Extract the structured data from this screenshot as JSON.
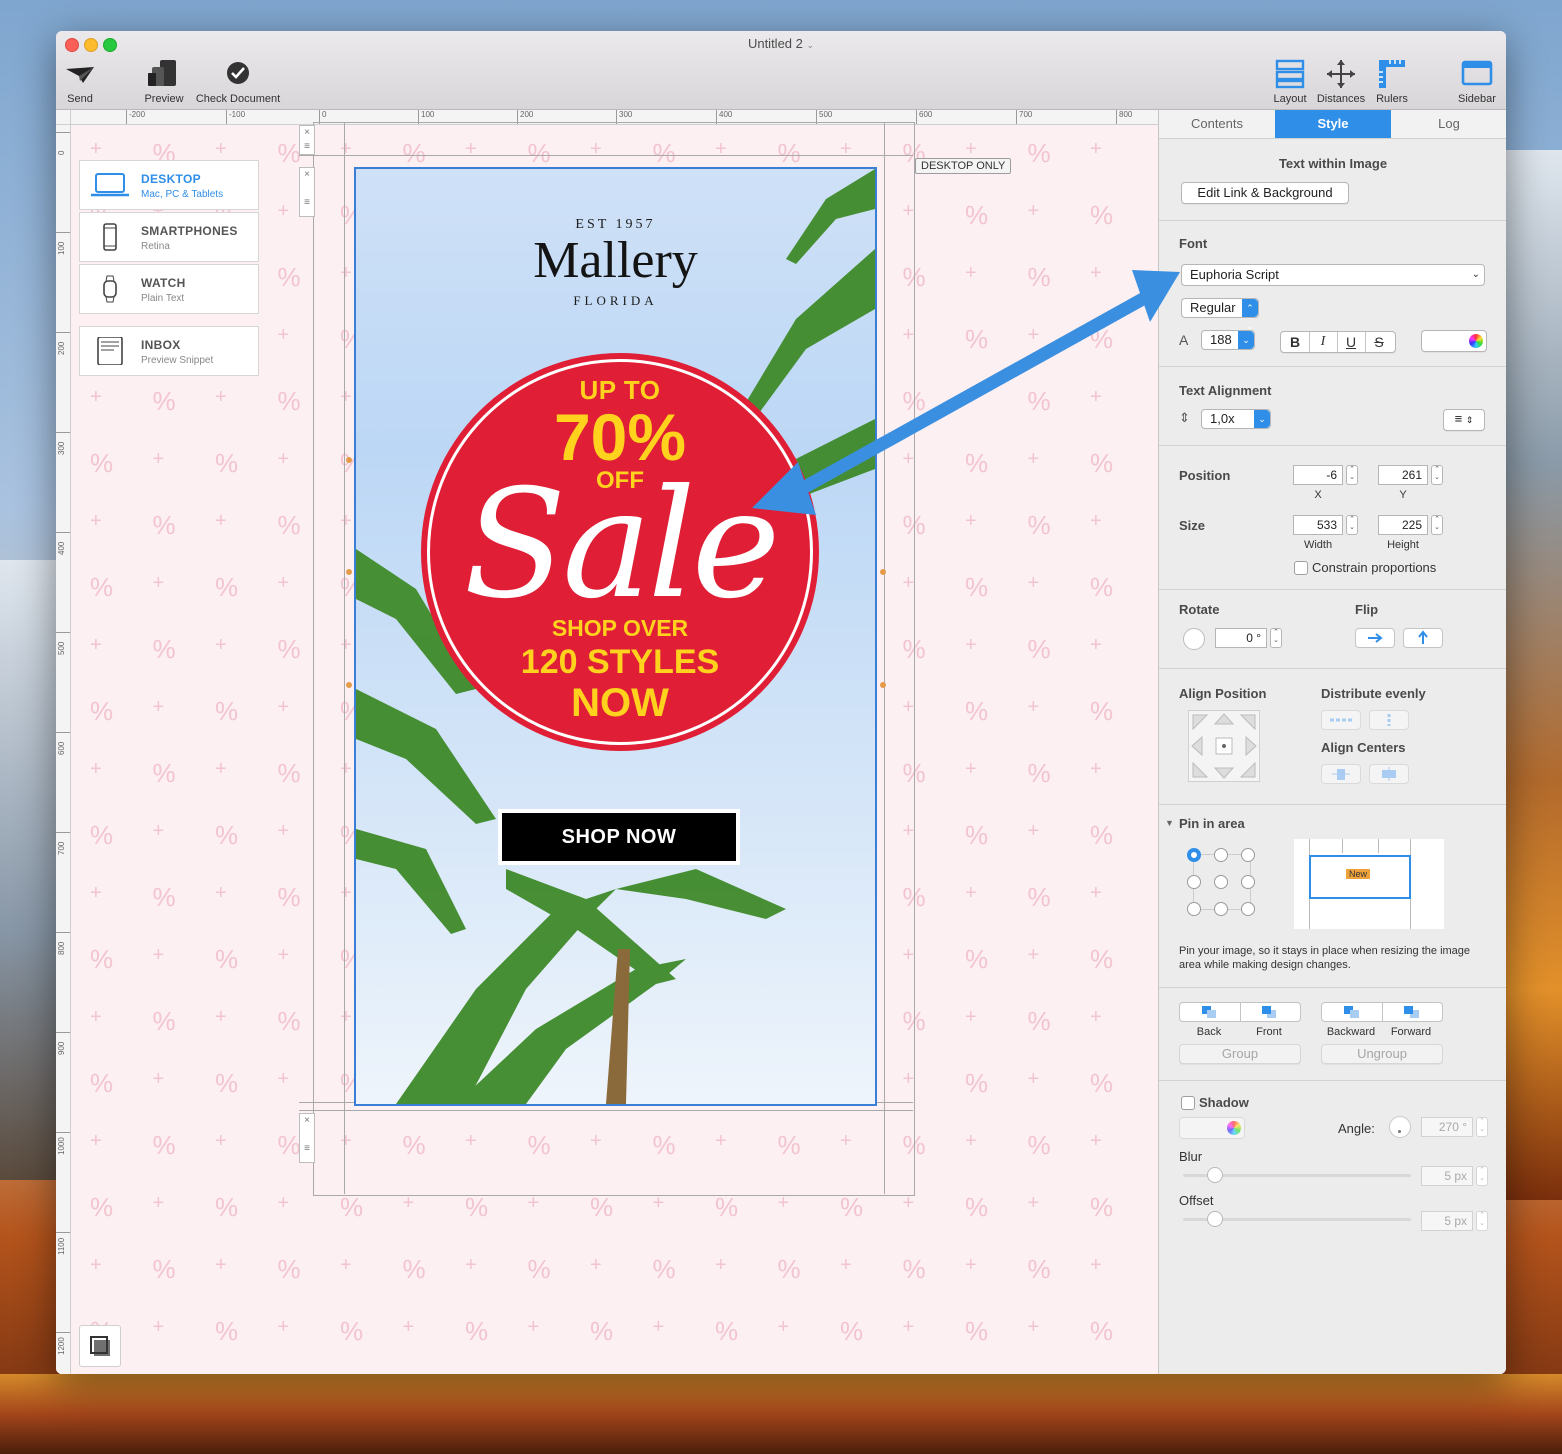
{
  "window": {
    "title": "Untitled 2"
  },
  "toolbar": {
    "send": "Send",
    "preview": "Preview",
    "check_document": "Check Document",
    "layout": "Layout",
    "distances": "Distances",
    "rulers": "Rulers",
    "sidebar": "Sidebar"
  },
  "rulers": {
    "h_ticks": [
      "-200",
      "-100",
      "0",
      "100",
      "200",
      "300",
      "400",
      "500",
      "600",
      "700",
      "800"
    ],
    "v_ticks": [
      "0",
      "100",
      "200",
      "300",
      "400",
      "500",
      "600",
      "700",
      "800",
      "900",
      "1000",
      "1100",
      "1200"
    ]
  },
  "devices": [
    {
      "name": "DESKTOP",
      "sub": "Mac, PC & Tablets",
      "active": true
    },
    {
      "name": "SMARTPHONES",
      "sub": "Retina",
      "active": false
    },
    {
      "name": "WATCH",
      "sub": "Plain Text",
      "active": false
    },
    {
      "name": "INBOX",
      "sub": "Preview Snippet",
      "active": false
    }
  ],
  "canvas": {
    "desktop_only_label": "DESKTOP ONLY"
  },
  "banner": {
    "est": "EST 1957",
    "brand": "Mallery",
    "location": "FLORIDA",
    "up_to": "UP TO",
    "percent": "70%",
    "off": "OFF",
    "sale": "Sale",
    "shop_over": "SHOP OVER",
    "styles": "120 STYLES",
    "now": "NOW",
    "cta": "SHOP NOW",
    "colors": {
      "badge": "#e01f36",
      "yellow": "#ffd21e",
      "selection": "#3a7fd6"
    }
  },
  "sidebar": {
    "tabs": [
      {
        "label": "Contents",
        "active": false
      },
      {
        "label": "Style",
        "active": true
      },
      {
        "label": "Log",
        "active": false
      }
    ],
    "text_within_image": {
      "heading": "Text within Image",
      "edit_button": "Edit Link & Background"
    },
    "font": {
      "heading": "Font",
      "family": "Euphoria Script",
      "weight": "Regular",
      "size": "188",
      "bold": "B",
      "italic": "I",
      "underline": "U",
      "strike": "S"
    },
    "text_alignment": {
      "heading": "Text Alignment",
      "line_height": "1,0x"
    },
    "position": {
      "heading": "Position",
      "x": "-6",
      "y": "261",
      "x_label": "X",
      "y_label": "Y"
    },
    "size": {
      "heading": "Size",
      "width": "533",
      "height": "225",
      "width_label": "Width",
      "height_label": "Height",
      "constrain": "Constrain proportions"
    },
    "rotate": {
      "heading": "Rotate",
      "value": "0 °"
    },
    "flip": {
      "heading": "Flip"
    },
    "align": {
      "position_heading": "Align Position",
      "distribute_heading": "Distribute evenly",
      "centers_heading": "Align Centers"
    },
    "pin": {
      "heading": "Pin in area",
      "new_label": "New",
      "help": "Pin your image, so it stays in place when resizing the image area while making design changes."
    },
    "arrange": {
      "back": "Back",
      "front": "Front",
      "backward": "Backward",
      "forward": "Forward",
      "group": "Group",
      "ungroup": "Ungroup"
    },
    "shadow": {
      "heading": "Shadow",
      "angle_label": "Angle:",
      "angle": "270 °",
      "blur_label": "Blur",
      "blur": "5 px",
      "offset_label": "Offset",
      "offset": "5 px"
    },
    "accent": "#2f8ee8"
  }
}
